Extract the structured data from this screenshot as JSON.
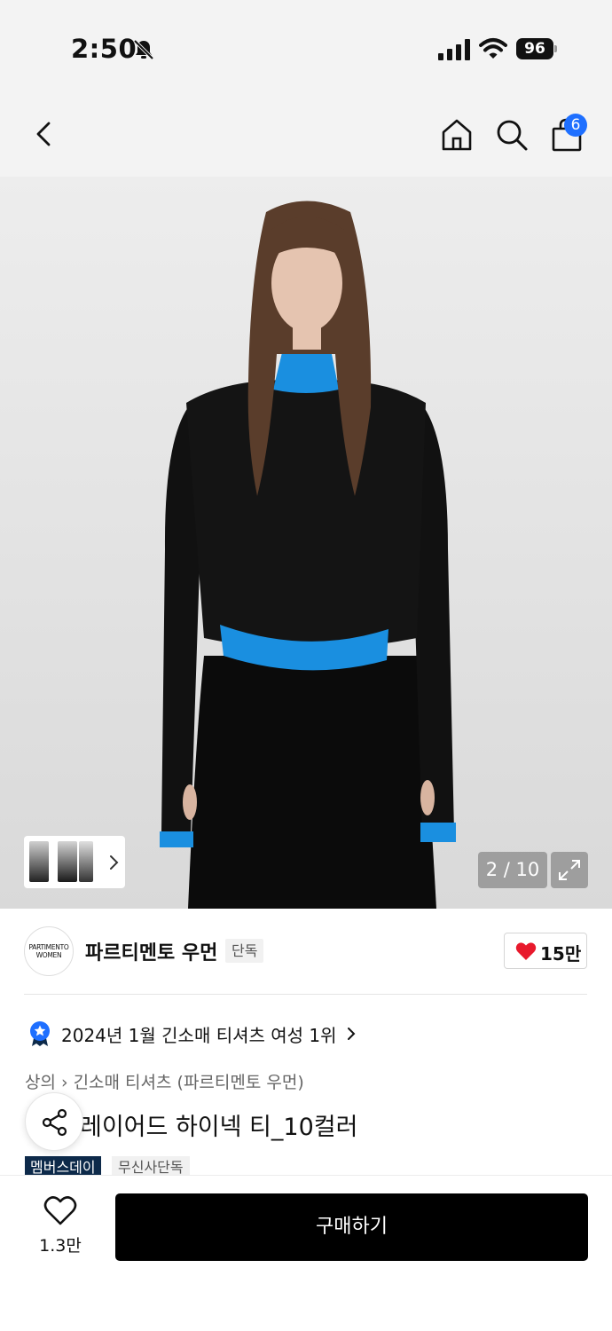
{
  "status_bar": {
    "time": "2:50",
    "battery": "96"
  },
  "nav": {
    "cart_badge": "6"
  },
  "gallery": {
    "page_indicator": "2 / 10"
  },
  "brand": {
    "logo_text_line1": "PARTIMENTO",
    "logo_text_line2": "WOMEN",
    "name": "파르티멘토 우먼",
    "exclusive_tag": "단독",
    "likes": "15만"
  },
  "ranking": {
    "text": "2024년 1월 긴소매 티셔츠 여성 1위"
  },
  "breadcrumb": {
    "category": "상의",
    "subcategory": "긴소매 티셔츠 (파르티멘토 우먼)"
  },
  "product": {
    "title": "레이어드 하이넥 티_10컬러",
    "tags": [
      "멤버스데이",
      "무신사단독"
    ]
  },
  "bottom": {
    "wish_count": "1.3만",
    "buy_label": "구매하기"
  },
  "colors": {
    "accent_blue": "#1e6fff",
    "heart_red": "#e8192c",
    "members_tag": "#0d2a4a"
  }
}
